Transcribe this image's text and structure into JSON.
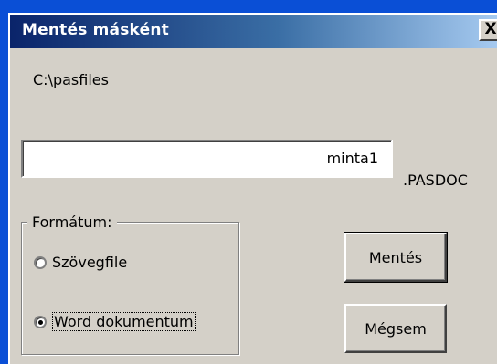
{
  "window": {
    "title": "Mentés másként",
    "close_label": "X"
  },
  "path": "C:\\pasfiles",
  "filename": {
    "value": "minta1",
    "extension": ".PASDOC"
  },
  "format": {
    "legend": "Formátum:",
    "options": [
      {
        "label": "Szövegfile",
        "checked": false
      },
      {
        "label": "Word dokumentum",
        "checked": true
      }
    ]
  },
  "buttons": {
    "save": "Mentés",
    "cancel": "Mégsem"
  }
}
